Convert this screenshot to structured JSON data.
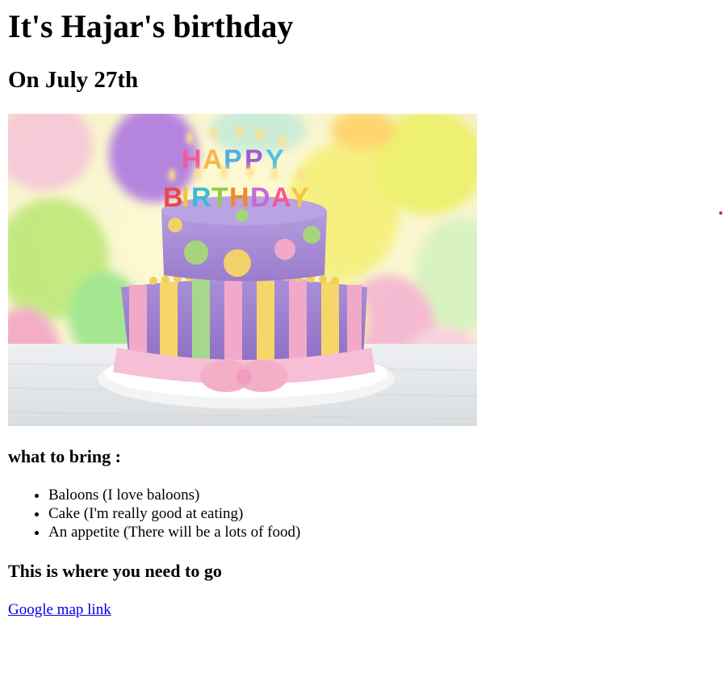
{
  "page": {
    "title": "It's Hajar's birthday",
    "subtitle": "On July 27th",
    "hero_image": {
      "alt": "birthday cake",
      "candle_letters": [
        "H",
        "A",
        "P",
        "P",
        "Y",
        "B",
        "I",
        "R",
        "T",
        "H",
        "D",
        "A",
        "Y"
      ],
      "icon": "birthday-cake-photo"
    },
    "bring_heading": "what to bring :",
    "bring_items": [
      "Baloons (I love baloons)",
      "Cake (I'm really good at eating)",
      "An appetite (There will be a lots of food)"
    ],
    "directions_heading": "This is where you need to go",
    "map_link": {
      "label": "Google map link"
    }
  },
  "colors": {
    "link": "#0000ee",
    "text": "#000000",
    "cursor_dot": "#e0202a"
  }
}
